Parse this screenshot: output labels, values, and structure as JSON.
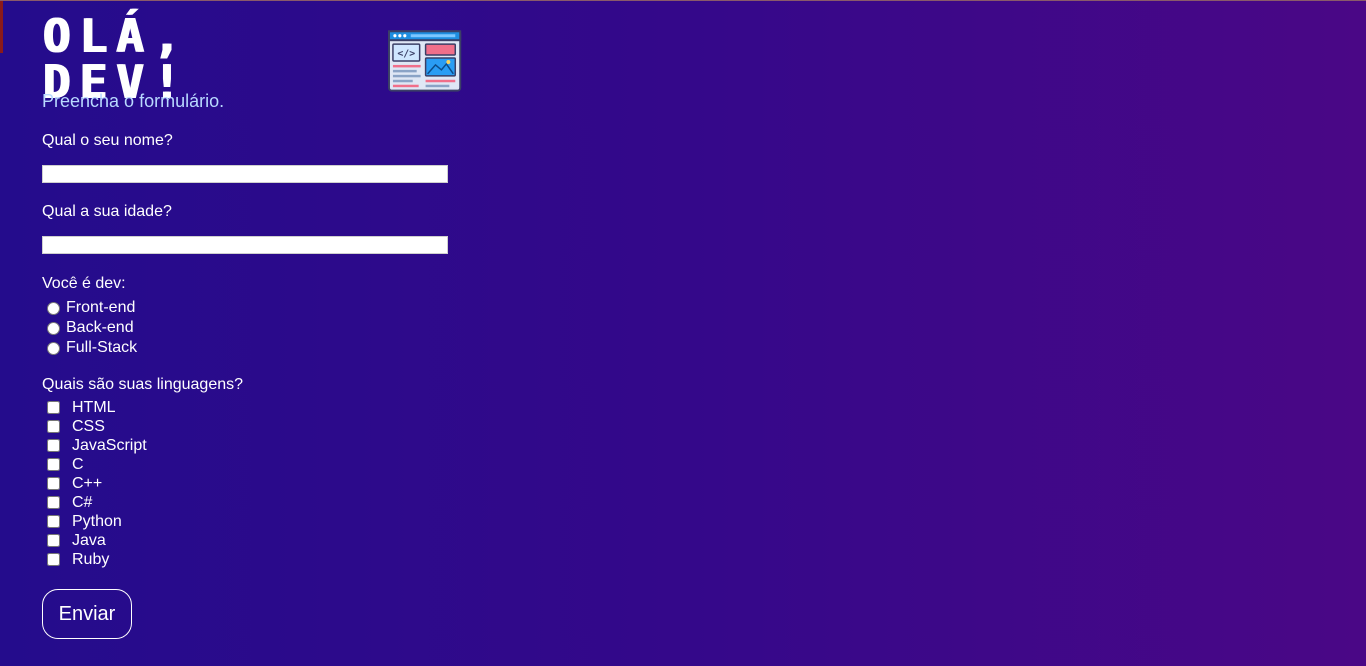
{
  "header": {
    "title": "OLÁ, DEV!",
    "subtitle": "Preencha o formulário.",
    "logo_icon": "web-page-code-icon"
  },
  "form": {
    "name_label": "Qual o seu nome?",
    "name_value": "",
    "age_label": "Qual a sua idade?",
    "age_value": "",
    "dev_label": "Você é dev:",
    "dev_options": [
      "Front-end",
      "Back-end",
      "Full-Stack"
    ],
    "languages_label": "Quais são suas linguagens?",
    "languages": [
      "HTML",
      "CSS",
      "JavaScript",
      "C",
      "C++",
      "C#",
      "Python",
      "Java",
      "Ruby"
    ],
    "submit_label": "Enviar"
  },
  "colors": {
    "background_start": "#240c8c",
    "background_end": "#4a0786",
    "subtitle": "#b9d9ff"
  }
}
